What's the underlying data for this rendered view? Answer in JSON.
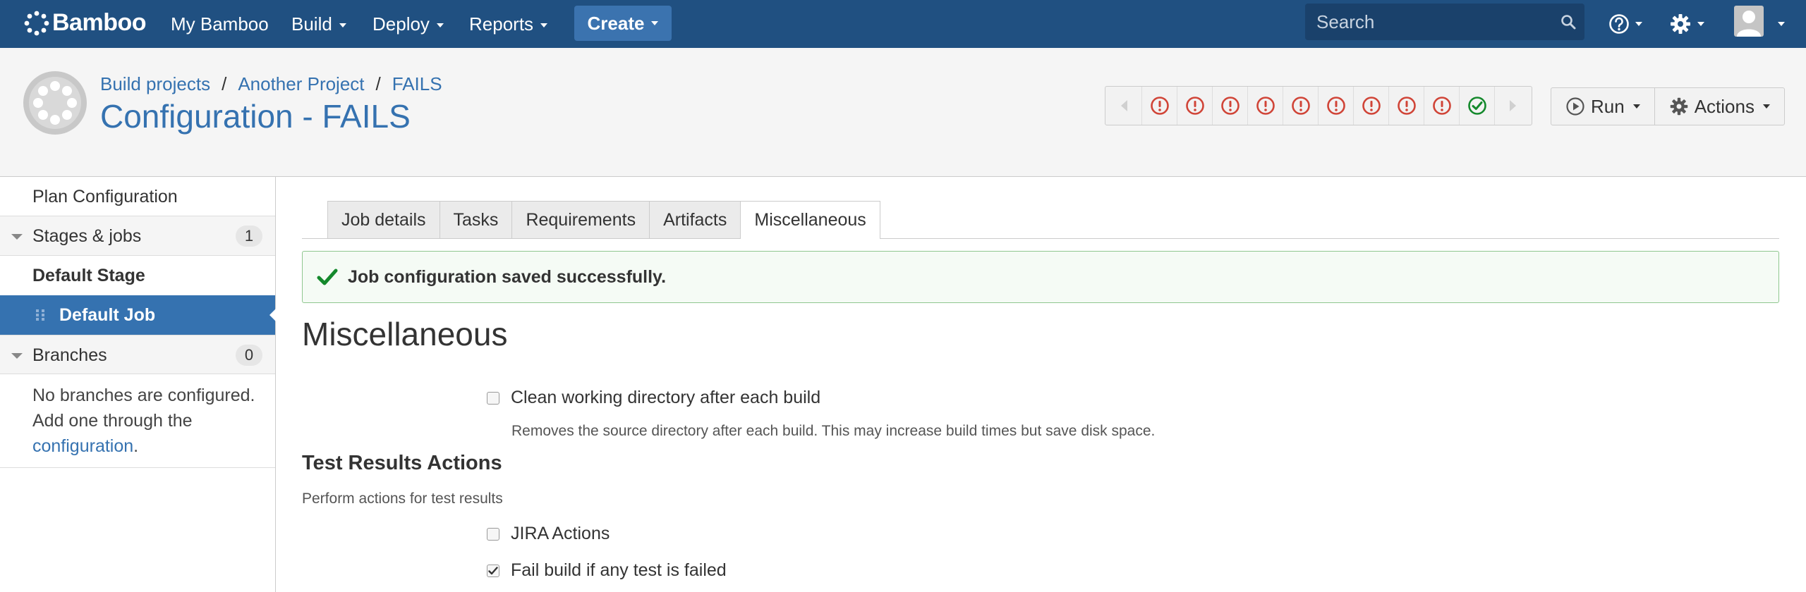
{
  "topnav": {
    "logo_text": "Bamboo",
    "items": [
      {
        "label": "My Bamboo",
        "dropdown": false
      },
      {
        "label": "Build",
        "dropdown": true
      },
      {
        "label": "Deploy",
        "dropdown": true
      },
      {
        "label": "Reports",
        "dropdown": true
      }
    ],
    "create_label": "Create",
    "search_placeholder": "Search",
    "bg_color": "#205081"
  },
  "header": {
    "breadcrumbs": [
      "Build projects",
      "Another Project",
      "FAILS"
    ],
    "separator": "/",
    "title": "Configuration - FAILS",
    "build_history": [
      "failed",
      "failed",
      "failed",
      "failed",
      "failed",
      "failed",
      "failed",
      "failed",
      "failed",
      "successful"
    ],
    "run_label": "Run",
    "actions_label": "Actions"
  },
  "sidebar": {
    "plan_configuration": "Plan Configuration",
    "stages_jobs": {
      "label": "Stages & jobs",
      "count": "1"
    },
    "stage": "Default Stage",
    "job": "Default Job",
    "branches": {
      "label": "Branches",
      "count": "0"
    },
    "branches_note_1": "No branches are configured.",
    "branches_note_2": "Add one through the",
    "branches_link": "configuration",
    "branches_note_end": "."
  },
  "tabs": [
    {
      "label": "Job details",
      "active": false
    },
    {
      "label": "Tasks",
      "active": false
    },
    {
      "label": "Requirements",
      "active": false
    },
    {
      "label": "Artifacts",
      "active": false
    },
    {
      "label": "Miscellaneous",
      "active": true
    }
  ],
  "main": {
    "success_message": "Job configuration saved successfully.",
    "heading": "Miscellaneous",
    "clean_dir": {
      "label": "Clean working directory after each build",
      "description": "Removes the source directory after each build. This may increase build times but save disk space.",
      "checked": false
    },
    "test_results_heading": "Test Results Actions",
    "test_results_desc": "Perform actions for test results",
    "jira_actions": {
      "label": "JIRA Actions",
      "checked": false
    },
    "fail_build": {
      "label": "Fail build if any test is failed",
      "checked": true
    }
  },
  "colors": {
    "link": "#3572b0",
    "failed": "#d04437",
    "success": "#14892c"
  }
}
